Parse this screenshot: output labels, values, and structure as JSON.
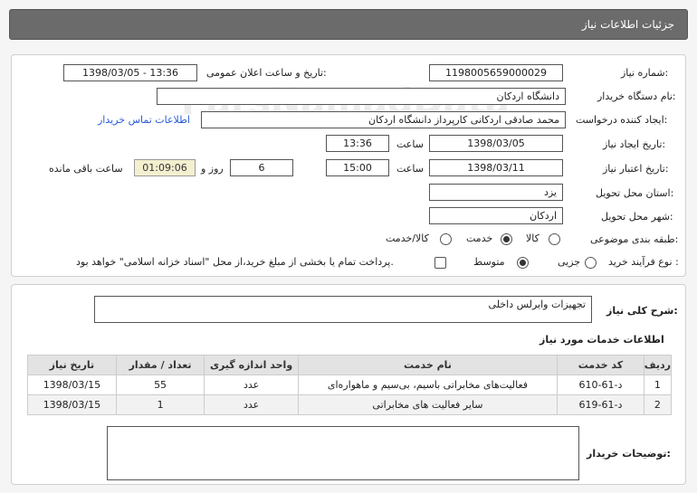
{
  "header": {
    "title": "جزئیات اطلاعات نیاز"
  },
  "form": {
    "need_number_label": "شماره نیاز:",
    "need_number": "1198005659000029",
    "announce_label": "تاریخ و ساعت اعلان عمومی:",
    "announce_value": "1398/03/05 - 13:36",
    "buyer_org_label": "نام دستگاه خریدار:",
    "buyer_org": "دانشگاه اردکان",
    "requester_label": "ایجاد کننده درخواست:",
    "requester": "محمد صادقی اردکانی کارپرداز دانشگاه اردکان",
    "contact_link": "اطلاعات تماس خریدار",
    "created_label": "تاریخ ایجاد نیاز:",
    "created_date": "1398/03/05",
    "hour_label": "ساعت",
    "created_time": "13:36",
    "validity_label": "تاریخ اعتبار نیاز:",
    "validity_date": "1398/03/11",
    "validity_time": "15:00",
    "days": "6",
    "days_label": "روز و",
    "remaining": "01:09:06",
    "remaining_label": "ساعت باقی مانده",
    "province_label": "استان محل تحویل:",
    "province": "یزد",
    "city_label": "شهر محل تحویل:",
    "city": "اردکان",
    "category_label": "طبقه بندی موضوعی:",
    "category_options": [
      "کالا",
      "خدمت",
      "کالا/خدمت"
    ],
    "process_label": "نوع فرآیند خرید :",
    "process_options": [
      "جزیی",
      "متوسط"
    ],
    "payment_note": "پرداخت تمام یا بخشی از مبلغ خرید،از محل \"اسناد خزانه اسلامی\" خواهد بود."
  },
  "summary": {
    "label": "شرح کلی نیاز:",
    "value": "تجهیزات وایرلس داخلی"
  },
  "services": {
    "title": "اطلاعات خدمات مورد نیاز",
    "columns": [
      "ردیف",
      "کد خدمت",
      "نام خدمت",
      "واحد اندازه گیری",
      "تعداد / مقدار",
      "تاریخ نیاز"
    ],
    "rows": [
      [
        "1",
        "د-61-610",
        "فعالیت‌های مخابراتی باسیم، بی‌سیم و ماهواره‌ای",
        "عدد",
        "55",
        "1398/03/15"
      ],
      [
        "2",
        "د-61-619",
        "سایر فعالیت های مخابراتی",
        "عدد",
        "1",
        "1398/03/15"
      ]
    ]
  },
  "buyer_notes": {
    "label": "توضیحات خریدار:",
    "value": ""
  },
  "watermark": "ParsNamadData"
}
